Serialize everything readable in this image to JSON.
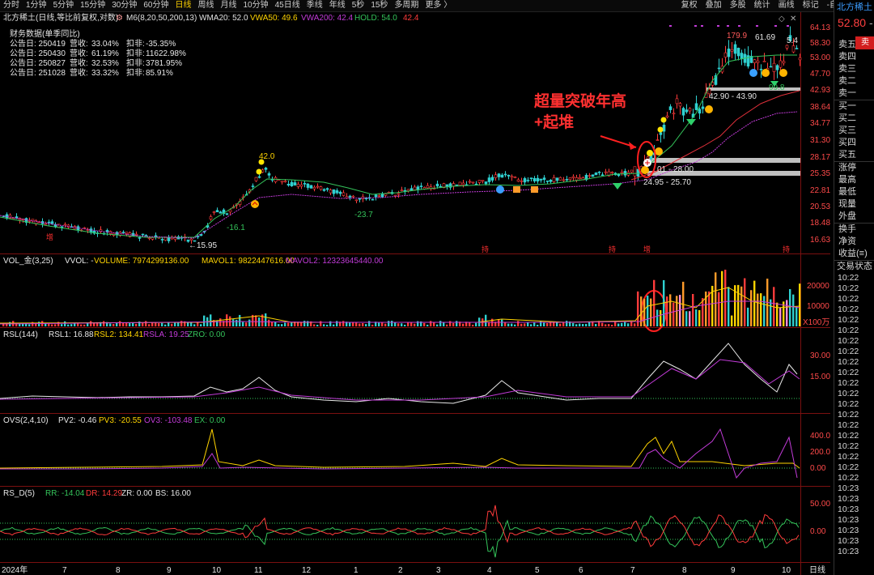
{
  "toolbar": {
    "periods": [
      "分时",
      "1分钟",
      "5分钟",
      "15分钟",
      "30分钟",
      "60分钟",
      "日线",
      "周线",
      "月线",
      "10分钟",
      "45日线",
      "季线",
      "年线",
      "5秒",
      "15秒",
      "多周期",
      "更多 〉"
    ],
    "active_period": "日线",
    "right_menu": [
      "复权",
      "叠加",
      "多股",
      "统计",
      "画线",
      "标记",
      "-自选",
      "返回"
    ]
  },
  "main_header": {
    "security": "北方稀土(日线,等比前复权,对数)",
    "settings_icon": "gear-icon",
    "ma_label": "M6(8,20,50,200,13)",
    "wma20": "WMA20: 52.0",
    "vwa50": "VWA50: 49.6",
    "vwa200": "VWA200: 42.4",
    "hold": "HOLD: 54.0",
    "hold_val": "42.4"
  },
  "fin_table": {
    "title": "财务数据(单季同比)",
    "rows": [
      {
        "date": "公告日: 250419",
        "rev": "营收:",
        "rev_v": "33.04%",
        "np": "扣非:",
        "np_v": "-35.35%"
      },
      {
        "date": "公告日: 250430",
        "rev": "营收:",
        "rev_v": "61.19%",
        "np": "扣非:",
        "np_v": "11622.98%"
      },
      {
        "date": "公告日: 250827",
        "rev": "营收:",
        "rev_v": "32.53%",
        "np": "扣非:",
        "np_v": "3781.95%"
      },
      {
        "date": "公告日: 251028",
        "rev": "营收:",
        "rev_v": "33.32%",
        "np": "扣非:",
        "np_v": "85.91%"
      }
    ]
  },
  "price_axis": [
    "64.13",
    "58.30",
    "53.00",
    "47.70",
    "42.93",
    "38.64",
    "34.77",
    "31.30",
    "28.17",
    "25.35",
    "22.81",
    "20.53",
    "18.48",
    "16.63"
  ],
  "price_labels": {
    "p42": "42.0",
    "p16": "-16.1",
    "p23": "-23.7",
    "p15": "←15.95",
    "p179": "179.9",
    "p61": "61.69",
    "p54": "5.4",
    "p99": "99.8",
    "zone1": "42.90 - 43.90",
    "zone2": "01 - 28.00",
    "zone3": "24.95 - 25.70"
  },
  "annotation": {
    "line1": "超量突破年高",
    "line2": "+起堆"
  },
  "markers": {
    "m1": "增",
    "m2": "持",
    "m3": "持",
    "m4": "增"
  },
  "vol_header": {
    "name": "VOL_金(3,25)",
    "vvol": "VVOL: -",
    "volume": "VOLUME: 7974299136.00",
    "mavol1": "MAVOL1: 9822447616.00",
    "mavol2": "MAVOL2: 12323645440.00"
  },
  "vol_axis": [
    "20000",
    "10000",
    "X100万"
  ],
  "rsl_header": {
    "name": "RSL(144)",
    "rsl1": "RSL1: 16.88",
    "rsl2": "RSL2: 134.41",
    "rsla": "RSLA: 19.25",
    "zro": "ZRO: 0.00"
  },
  "rsl_axis": [
    "30.00",
    "15.00"
  ],
  "ovs_header": {
    "name": "OVS(2,4,10)",
    "pv2": "PV2: -0.46",
    "pv3": "PV3: -20.55",
    "ov3": "OV3: -103.48",
    "ex": "EX: 0.00"
  },
  "ovs_axis": [
    "400.0",
    "200.0",
    "0.00"
  ],
  "rsd_header": {
    "name": "RS_D(5)",
    "rr": "RR: -14.04",
    "dr": "DR: 14.29",
    "zr": "ZR: 0.00",
    "bs": "BS: 16.00"
  },
  "rsd_axis": [
    "50.00",
    "0.00"
  ],
  "date_axis": [
    "2024年",
    "7",
    "8",
    "9",
    "10",
    "11",
    "12",
    "1",
    "2",
    "3",
    "4",
    "5",
    "6",
    "7",
    "8",
    "9",
    "10"
  ],
  "date_period": "日线",
  "right_panel": {
    "stock": "北方稀土",
    "price": "52.80",
    "change": "-",
    "sell_label": "卖",
    "levels": [
      "卖五",
      "卖四",
      "卖三",
      "卖二",
      "卖一",
      "买一",
      "买二",
      "买三",
      "买四",
      "买五"
    ],
    "fields": [
      "涨停",
      "最高",
      "最低",
      "现量",
      "外盘",
      "换手",
      "净资",
      "收益(≡)"
    ],
    "trade_status": "交易状态",
    "times": [
      "10:22",
      "10:22",
      "10:22",
      "10:22",
      "10:22",
      "10:22",
      "10:22",
      "10:22",
      "10:22",
      "10:22",
      "10:22",
      "10:22",
      "10:22",
      "10:22",
      "10:22",
      "10:22",
      "10:22",
      "10:22",
      "10:22",
      "10:22",
      "10:23",
      "10:23",
      "10:23",
      "10:23",
      "10:23",
      "10:23",
      "10:23"
    ]
  },
  "colors": {
    "up": "#ff3b3b",
    "down": "#2fd0d0",
    "ma_green": "#34c35a",
    "ma_purple": "#c23bd8",
    "ma_red": "#e0303a",
    "yellow": "#ffd400"
  }
}
